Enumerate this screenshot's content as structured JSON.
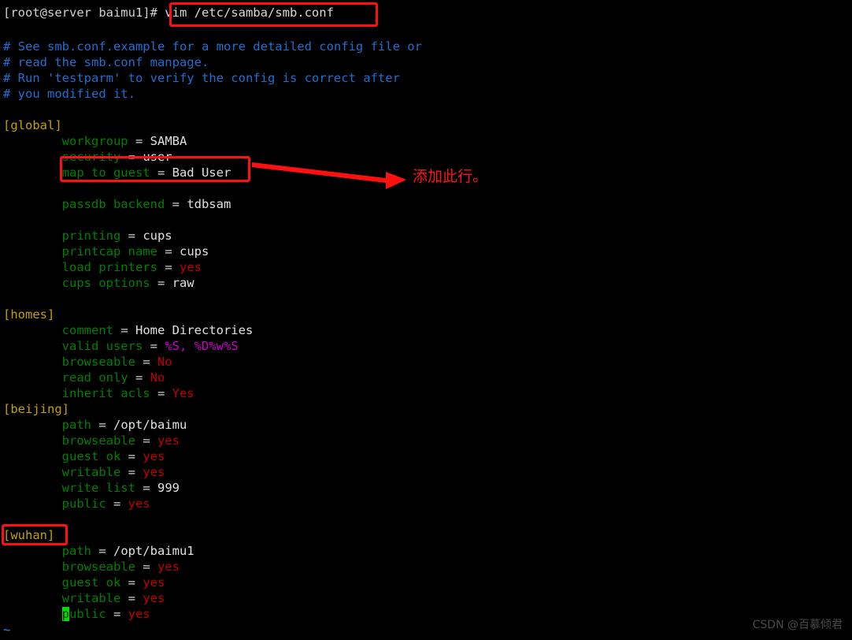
{
  "terminal": {
    "prompt": "[root@server baimu1]#",
    "command": "vim /etc/samba/smb.conf",
    "tilde": "~",
    "watermark": "CSDN @百慕倾君"
  },
  "annotation": {
    "box_command_label": "vim /etc/samba/smb.conf",
    "box_map_label": "map to guest = Bad User",
    "box_section_label": "[wuhan]",
    "arrow_label": "arrow-pointing-right",
    "note_text": "添加此行。"
  },
  "colors": {
    "background": "#000000",
    "comment": "#1f6fd0",
    "section": "#c5a000",
    "key": "#007f00",
    "value": "#c00000",
    "variable": "#c800c8",
    "plain": "#e0e0e0",
    "annotation": "#ff1414",
    "cursor": "#00dd00",
    "window_edge": "#1e8ad6"
  },
  "file": {
    "lines": [
      {
        "type": "comment",
        "text": "# See smb.conf.example for a more detailed config file or"
      },
      {
        "type": "comment",
        "text": "# read the smb.conf manpage."
      },
      {
        "type": "comment",
        "text": "# Run 'testparm' to verify the config is correct after"
      },
      {
        "type": "comment",
        "text": "# you modified it."
      },
      {
        "type": "blank",
        "text": ""
      },
      {
        "type": "section",
        "text": "[global]"
      },
      {
        "type": "pair",
        "key": "workgroup",
        "value": "SAMBA",
        "value_kind": "plain"
      },
      {
        "type": "pair",
        "key": "security",
        "value": "user",
        "value_kind": "plain"
      },
      {
        "type": "pair",
        "key": "map to guest",
        "value": "Bad User",
        "value_kind": "plain"
      },
      {
        "type": "blank",
        "text": ""
      },
      {
        "type": "pair",
        "key": "passdb backend",
        "value": "tdbsam",
        "value_kind": "plain"
      },
      {
        "type": "blank",
        "text": ""
      },
      {
        "type": "pair",
        "key": "printing",
        "value": "cups",
        "value_kind": "plain"
      },
      {
        "type": "pair",
        "key": "printcap name",
        "value": "cups",
        "value_kind": "plain"
      },
      {
        "type": "pair",
        "key": "load printers",
        "value": "yes",
        "value_kind": "bool"
      },
      {
        "type": "pair",
        "key": "cups options",
        "value": "raw",
        "value_kind": "plain"
      },
      {
        "type": "blank",
        "text": ""
      },
      {
        "type": "section",
        "text": "[homes]"
      },
      {
        "type": "pair",
        "key": "comment",
        "value": "Home Directories",
        "value_kind": "plain"
      },
      {
        "type": "pair",
        "key": "valid users",
        "value": "%S, %D%w%S",
        "value_kind": "var"
      },
      {
        "type": "pair",
        "key": "browseable",
        "value": "No",
        "value_kind": "bool"
      },
      {
        "type": "pair",
        "key": "read only",
        "value": "No",
        "value_kind": "bool"
      },
      {
        "type": "pair",
        "key": "inherit acls",
        "value": "Yes",
        "value_kind": "bool"
      },
      {
        "type": "section",
        "text": "[beijing]"
      },
      {
        "type": "pair",
        "key": "path",
        "value": "/opt/baimu",
        "value_kind": "plain"
      },
      {
        "type": "pair",
        "key": "browseable",
        "value": "yes",
        "value_kind": "bool"
      },
      {
        "type": "pair",
        "key": "guest ok",
        "value": "yes",
        "value_kind": "bool"
      },
      {
        "type": "pair",
        "key": "writable",
        "value": "yes",
        "value_kind": "bool"
      },
      {
        "type": "pair",
        "key": "write list",
        "value": "999",
        "value_kind": "plain"
      },
      {
        "type": "pair",
        "key": "public",
        "value": "yes",
        "value_kind": "bool"
      },
      {
        "type": "blank",
        "text": ""
      },
      {
        "type": "section",
        "text": "[wuhan]"
      },
      {
        "type": "pair",
        "key": "path",
        "value": "/opt/baimu1",
        "value_kind": "plain"
      },
      {
        "type": "pair",
        "key": "browseable",
        "value": "yes",
        "value_kind": "bool"
      },
      {
        "type": "pair",
        "key": "guest ok",
        "value": "yes",
        "value_kind": "bool"
      },
      {
        "type": "pair",
        "key": "writable",
        "value": "yes",
        "value_kind": "bool"
      },
      {
        "type": "pair",
        "key": "public",
        "value": "yes",
        "value_kind": "bool",
        "cursor_at": 0
      }
    ]
  }
}
